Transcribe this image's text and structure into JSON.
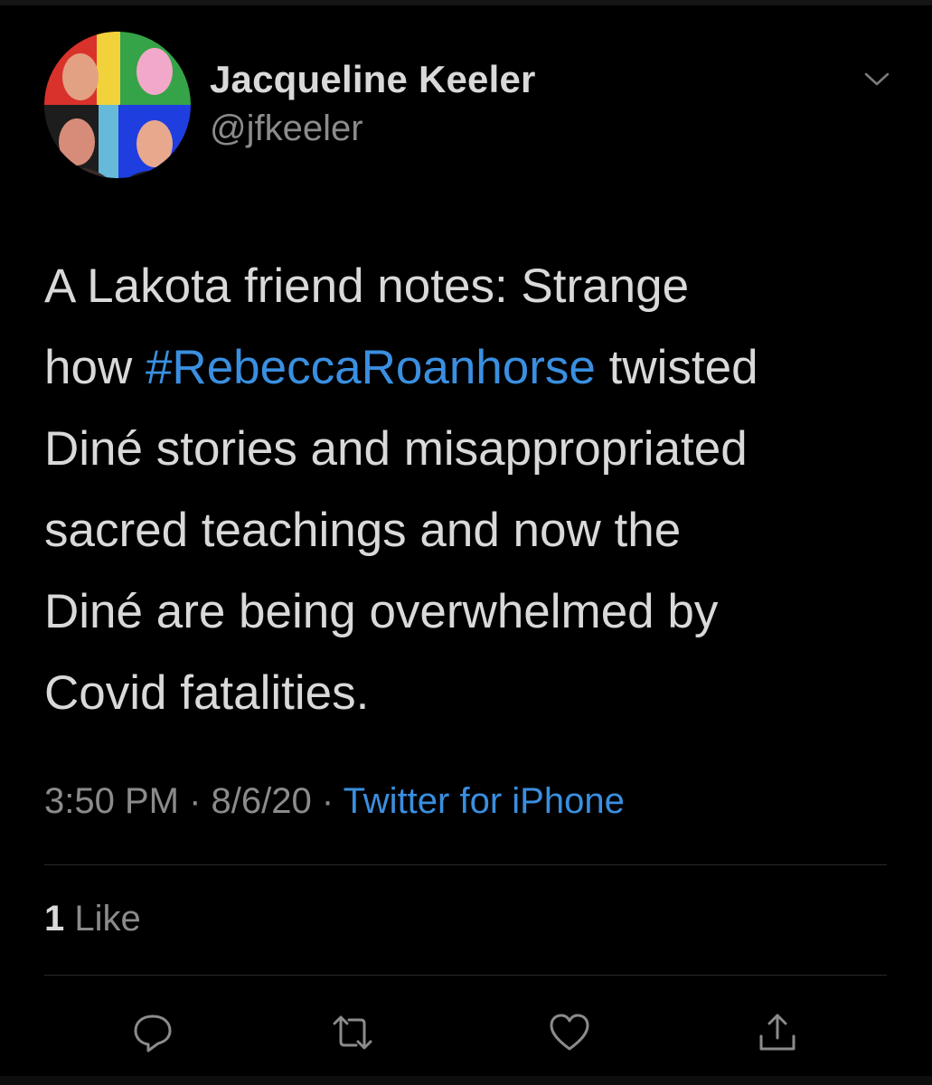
{
  "user": {
    "display_name": "Jacqueline Keeler",
    "handle": "@jfkeeler"
  },
  "tweet": {
    "lines": [
      [
        {
          "text": "A Lakota friend notes: Strange"
        }
      ],
      [
        {
          "text": "how "
        },
        {
          "text": "#RebeccaRoanhorse",
          "hashtag": true
        },
        {
          "text": " twisted"
        }
      ],
      [
        {
          "text": "Diné stories and misappropriated"
        }
      ],
      [
        {
          "text": "sacred teachings and now the"
        }
      ],
      [
        {
          "text": "Diné are being overwhelmed by"
        }
      ],
      [
        {
          "text": "Covid fatalities."
        }
      ]
    ]
  },
  "meta": {
    "time": "3:50 PM",
    "separator": " · ",
    "date": "8/6/20",
    "source": "Twitter for iPhone"
  },
  "engagement": {
    "like_count": "1",
    "like_label": "Like"
  },
  "icons": {
    "menu": "chevron-down-icon",
    "reply": "reply-icon",
    "retweet": "retweet-icon",
    "like": "heart-icon",
    "share": "share-icon"
  },
  "colors": {
    "background": "#000000",
    "text": "#d9d9d9",
    "secondary": "#8b8b8b",
    "link": "#3a8fe0",
    "divider": "#2a2a2a"
  }
}
